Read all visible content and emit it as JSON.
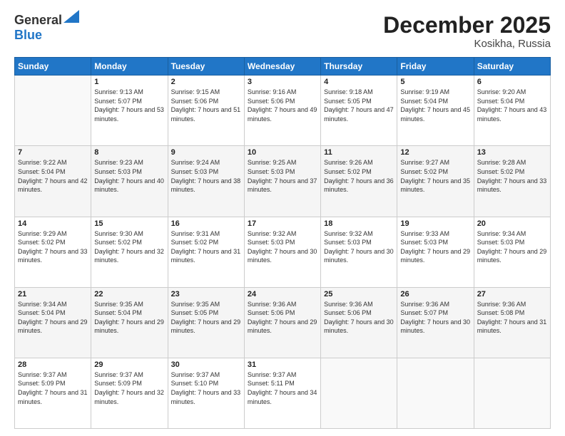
{
  "header": {
    "logo_line1": "General",
    "logo_line2": "Blue",
    "month": "December 2025",
    "location": "Kosikha, Russia"
  },
  "days_of_week": [
    "Sunday",
    "Monday",
    "Tuesday",
    "Wednesday",
    "Thursday",
    "Friday",
    "Saturday"
  ],
  "weeks": [
    [
      {
        "day": "",
        "sunrise": "",
        "sunset": "",
        "daylight": ""
      },
      {
        "day": "1",
        "sunrise": "Sunrise: 9:13 AM",
        "sunset": "Sunset: 5:07 PM",
        "daylight": "Daylight: 7 hours and 53 minutes."
      },
      {
        "day": "2",
        "sunrise": "Sunrise: 9:15 AM",
        "sunset": "Sunset: 5:06 PM",
        "daylight": "Daylight: 7 hours and 51 minutes."
      },
      {
        "day": "3",
        "sunrise": "Sunrise: 9:16 AM",
        "sunset": "Sunset: 5:06 PM",
        "daylight": "Daylight: 7 hours and 49 minutes."
      },
      {
        "day": "4",
        "sunrise": "Sunrise: 9:18 AM",
        "sunset": "Sunset: 5:05 PM",
        "daylight": "Daylight: 7 hours and 47 minutes."
      },
      {
        "day": "5",
        "sunrise": "Sunrise: 9:19 AM",
        "sunset": "Sunset: 5:04 PM",
        "daylight": "Daylight: 7 hours and 45 minutes."
      },
      {
        "day": "6",
        "sunrise": "Sunrise: 9:20 AM",
        "sunset": "Sunset: 5:04 PM",
        "daylight": "Daylight: 7 hours and 43 minutes."
      }
    ],
    [
      {
        "day": "7",
        "sunrise": "Sunrise: 9:22 AM",
        "sunset": "Sunset: 5:04 PM",
        "daylight": "Daylight: 7 hours and 42 minutes."
      },
      {
        "day": "8",
        "sunrise": "Sunrise: 9:23 AM",
        "sunset": "Sunset: 5:03 PM",
        "daylight": "Daylight: 7 hours and 40 minutes."
      },
      {
        "day": "9",
        "sunrise": "Sunrise: 9:24 AM",
        "sunset": "Sunset: 5:03 PM",
        "daylight": "Daylight: 7 hours and 38 minutes."
      },
      {
        "day": "10",
        "sunrise": "Sunrise: 9:25 AM",
        "sunset": "Sunset: 5:03 PM",
        "daylight": "Daylight: 7 hours and 37 minutes."
      },
      {
        "day": "11",
        "sunrise": "Sunrise: 9:26 AM",
        "sunset": "Sunset: 5:02 PM",
        "daylight": "Daylight: 7 hours and 36 minutes."
      },
      {
        "day": "12",
        "sunrise": "Sunrise: 9:27 AM",
        "sunset": "Sunset: 5:02 PM",
        "daylight": "Daylight: 7 hours and 35 minutes."
      },
      {
        "day": "13",
        "sunrise": "Sunrise: 9:28 AM",
        "sunset": "Sunset: 5:02 PM",
        "daylight": "Daylight: 7 hours and 33 minutes."
      }
    ],
    [
      {
        "day": "14",
        "sunrise": "Sunrise: 9:29 AM",
        "sunset": "Sunset: 5:02 PM",
        "daylight": "Daylight: 7 hours and 33 minutes."
      },
      {
        "day": "15",
        "sunrise": "Sunrise: 9:30 AM",
        "sunset": "Sunset: 5:02 PM",
        "daylight": "Daylight: 7 hours and 32 minutes."
      },
      {
        "day": "16",
        "sunrise": "Sunrise: 9:31 AM",
        "sunset": "Sunset: 5:02 PM",
        "daylight": "Daylight: 7 hours and 31 minutes."
      },
      {
        "day": "17",
        "sunrise": "Sunrise: 9:32 AM",
        "sunset": "Sunset: 5:03 PM",
        "daylight": "Daylight: 7 hours and 30 minutes."
      },
      {
        "day": "18",
        "sunrise": "Sunrise: 9:32 AM",
        "sunset": "Sunset: 5:03 PM",
        "daylight": "Daylight: 7 hours and 30 minutes."
      },
      {
        "day": "19",
        "sunrise": "Sunrise: 9:33 AM",
        "sunset": "Sunset: 5:03 PM",
        "daylight": "Daylight: 7 hours and 29 minutes."
      },
      {
        "day": "20",
        "sunrise": "Sunrise: 9:34 AM",
        "sunset": "Sunset: 5:03 PM",
        "daylight": "Daylight: 7 hours and 29 minutes."
      }
    ],
    [
      {
        "day": "21",
        "sunrise": "Sunrise: 9:34 AM",
        "sunset": "Sunset: 5:04 PM",
        "daylight": "Daylight: 7 hours and 29 minutes."
      },
      {
        "day": "22",
        "sunrise": "Sunrise: 9:35 AM",
        "sunset": "Sunset: 5:04 PM",
        "daylight": "Daylight: 7 hours and 29 minutes."
      },
      {
        "day": "23",
        "sunrise": "Sunrise: 9:35 AM",
        "sunset": "Sunset: 5:05 PM",
        "daylight": "Daylight: 7 hours and 29 minutes."
      },
      {
        "day": "24",
        "sunrise": "Sunrise: 9:36 AM",
        "sunset": "Sunset: 5:06 PM",
        "daylight": "Daylight: 7 hours and 29 minutes."
      },
      {
        "day": "25",
        "sunrise": "Sunrise: 9:36 AM",
        "sunset": "Sunset: 5:06 PM",
        "daylight": "Daylight: 7 hours and 30 minutes."
      },
      {
        "day": "26",
        "sunrise": "Sunrise: 9:36 AM",
        "sunset": "Sunset: 5:07 PM",
        "daylight": "Daylight: 7 hours and 30 minutes."
      },
      {
        "day": "27",
        "sunrise": "Sunrise: 9:36 AM",
        "sunset": "Sunset: 5:08 PM",
        "daylight": "Daylight: 7 hours and 31 minutes."
      }
    ],
    [
      {
        "day": "28",
        "sunrise": "Sunrise: 9:37 AM",
        "sunset": "Sunset: 5:09 PM",
        "daylight": "Daylight: 7 hours and 31 minutes."
      },
      {
        "day": "29",
        "sunrise": "Sunrise: 9:37 AM",
        "sunset": "Sunset: 5:09 PM",
        "daylight": "Daylight: 7 hours and 32 minutes."
      },
      {
        "day": "30",
        "sunrise": "Sunrise: 9:37 AM",
        "sunset": "Sunset: 5:10 PM",
        "daylight": "Daylight: 7 hours and 33 minutes."
      },
      {
        "day": "31",
        "sunrise": "Sunrise: 9:37 AM",
        "sunset": "Sunset: 5:11 PM",
        "daylight": "Daylight: 7 hours and 34 minutes."
      },
      {
        "day": "",
        "sunrise": "",
        "sunset": "",
        "daylight": ""
      },
      {
        "day": "",
        "sunrise": "",
        "sunset": "",
        "daylight": ""
      },
      {
        "day": "",
        "sunrise": "",
        "sunset": "",
        "daylight": ""
      }
    ]
  ]
}
